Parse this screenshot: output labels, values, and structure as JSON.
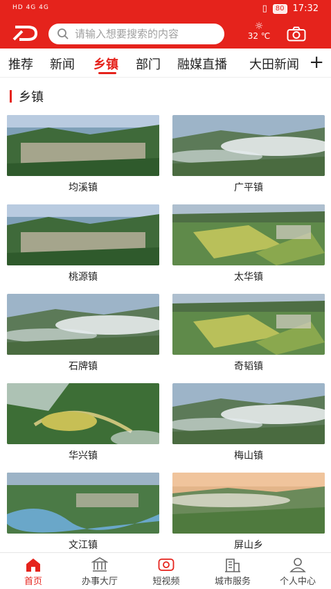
{
  "status_bar": {
    "signal_text": "HD 4G 4G",
    "time": "17:32",
    "battery": "80"
  },
  "header": {
    "search_placeholder": "请输入想要搜索的内容",
    "weather_temp": "32 ℃"
  },
  "tabs": [
    {
      "label": "推荐",
      "active": false
    },
    {
      "label": "新闻",
      "active": false
    },
    {
      "label": "乡镇",
      "active": true
    },
    {
      "label": "部门",
      "active": false
    },
    {
      "label": "融媒直播",
      "active": false
    },
    {
      "label": "大田新闻",
      "active": false
    }
  ],
  "section": {
    "title": "乡镇"
  },
  "towns": [
    {
      "name": "均溪镇",
      "scene": "town"
    },
    {
      "name": "广平镇",
      "scene": "mist"
    },
    {
      "name": "桃源镇",
      "scene": "town"
    },
    {
      "name": "太华镇",
      "scene": "fields"
    },
    {
      "name": "石牌镇",
      "scene": "mist"
    },
    {
      "name": "奇韬镇",
      "scene": "fields"
    },
    {
      "name": "华兴镇",
      "scene": "green"
    },
    {
      "name": "梅山镇",
      "scene": "mist"
    },
    {
      "name": "文江镇",
      "scene": "river"
    },
    {
      "name": "屏山乡",
      "scene": "sunset"
    }
  ],
  "bottom_nav": [
    {
      "label": "首页",
      "icon": "home-icon",
      "active": true
    },
    {
      "label": "办事大厅",
      "icon": "hall-icon",
      "active": false
    },
    {
      "label": "短视频",
      "icon": "video-icon",
      "active": false
    },
    {
      "label": "城市服务",
      "icon": "city-icon",
      "active": false
    },
    {
      "label": "个人中心",
      "icon": "user-icon",
      "active": false
    }
  ],
  "colors": {
    "brand_red": "#e5231c"
  }
}
